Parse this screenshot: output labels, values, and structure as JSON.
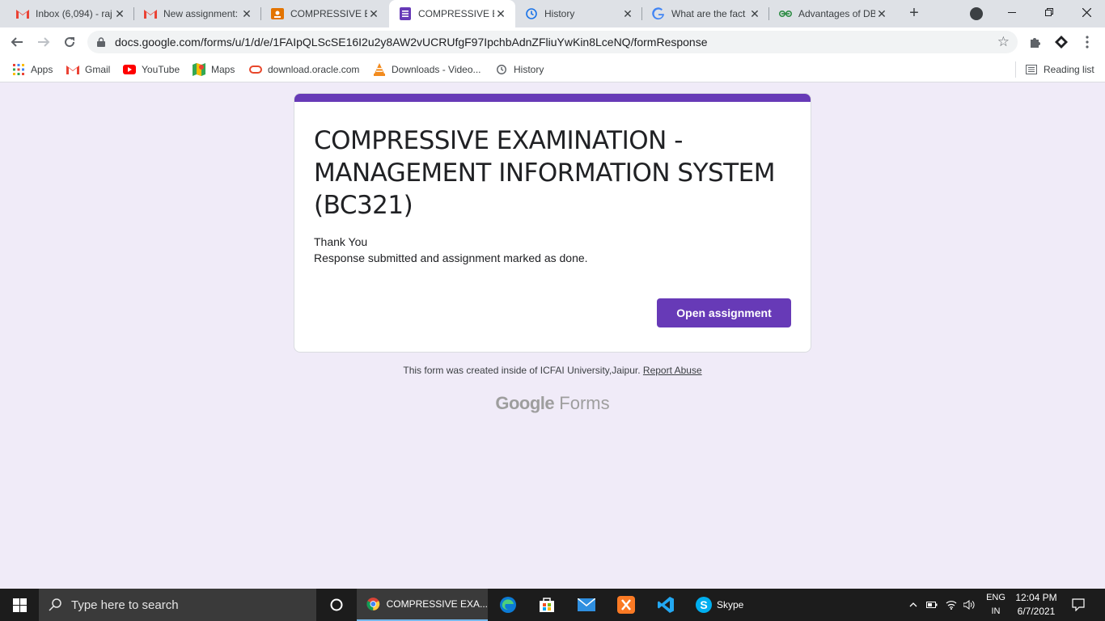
{
  "browser": {
    "tabs": [
      {
        "title": "Inbox (6,094) - raj",
        "icon": "gmail-icon"
      },
      {
        "title": "New assignment:",
        "icon": "gmail-icon"
      },
      {
        "title": "COMPRESSIVE EX",
        "icon": "classroom-icon"
      },
      {
        "title": "COMPRESSIVE EX",
        "icon": "google-forms-icon"
      },
      {
        "title": "History",
        "icon": "history-icon"
      },
      {
        "title": "What are the fact",
        "icon": "google-icon"
      },
      {
        "title": "Advantages of DB",
        "icon": "geeksforgeeks-icon"
      }
    ],
    "new_tab": "+",
    "address": "docs.google.com/forms/u/1/d/e/1FAIpQLScSE16I2u2y8AW2vUCRUfgF97IpchbAdnZFliuYwKin8LceNQ/formResponse",
    "bookmarks": [
      {
        "label": "Apps",
        "icon": "apps-grid-icon"
      },
      {
        "label": "Gmail",
        "icon": "gmail-icon"
      },
      {
        "label": "YouTube",
        "icon": "youtube-icon"
      },
      {
        "label": "Maps",
        "icon": "maps-icon"
      },
      {
        "label": "download.oracle.com",
        "icon": "oracle-icon"
      },
      {
        "label": "Downloads - Video...",
        "icon": "vlc-icon"
      },
      {
        "label": "History",
        "icon": "history-icon"
      }
    ],
    "reading_list": "Reading list"
  },
  "form": {
    "title": "COMPRESSIVE EXAMINATION - MANAGEMENT INFORMATION SYSTEM (BC321)",
    "thank_you": "Thank You",
    "confirmation": "Response submitted and assignment marked as done.",
    "open_assignment": "Open assignment",
    "footer_text": "This form was created inside of ICFAI University,Jaipur.",
    "report_abuse": "Report Abuse",
    "brand_google": "Google",
    "brand_forms": "Forms",
    "accent_color": "#673ab7",
    "background_color": "#f0ebf8"
  },
  "taskbar": {
    "search_placeholder": "Type here to search",
    "active_app": "COMPRESSIVE EXA...",
    "skype": "Skype",
    "lang_top": "ENG",
    "lang_bottom": "IN",
    "time": "12:04 PM",
    "date": "6/7/2021"
  }
}
